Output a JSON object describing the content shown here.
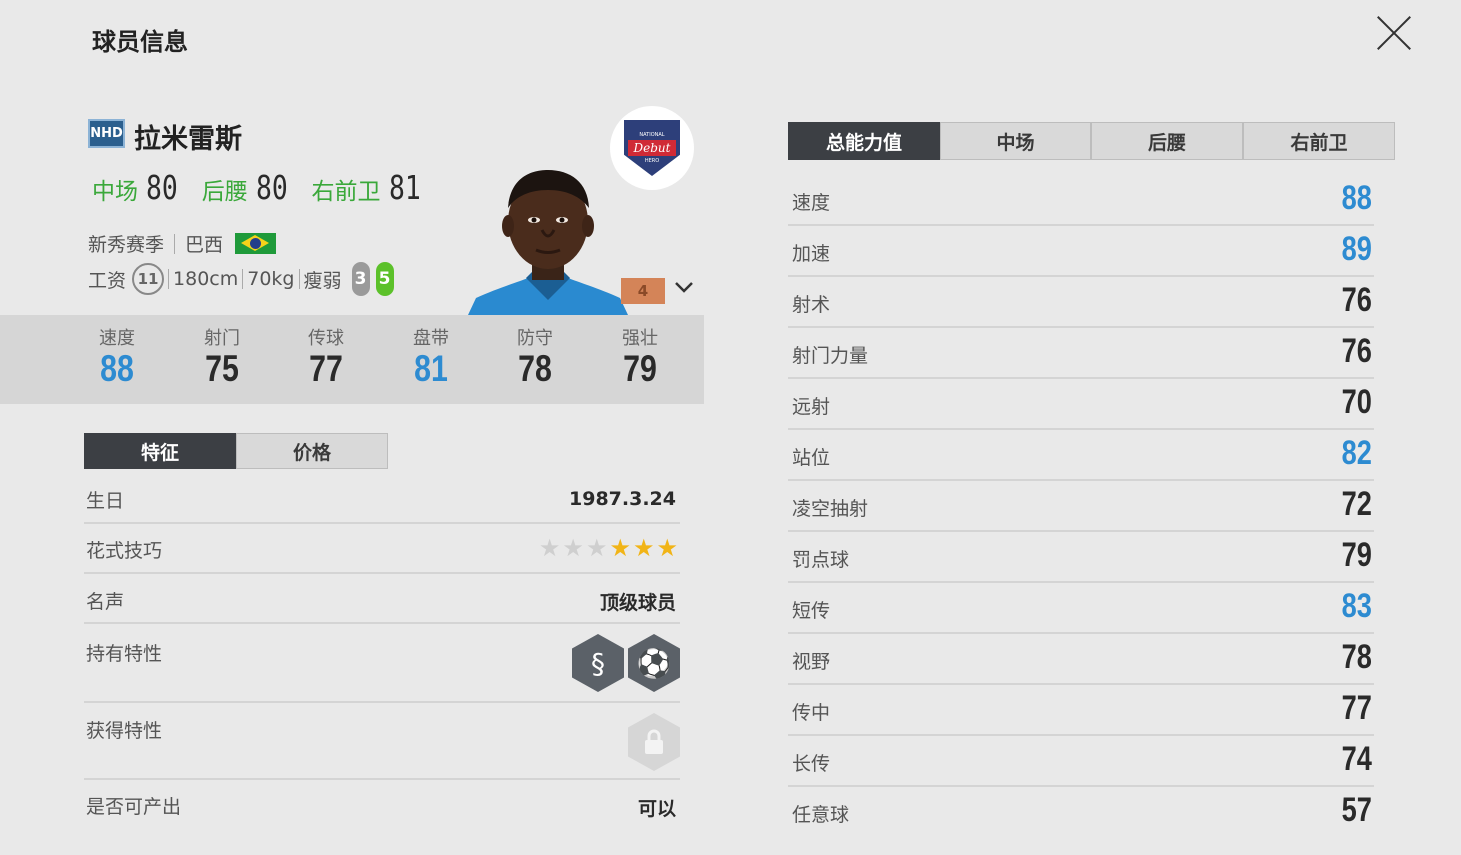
{
  "header": {
    "title": "球员信息",
    "close_icon": "close-icon"
  },
  "player": {
    "season_badge": "NHD",
    "name": "拉米雷斯",
    "positions": [
      {
        "name": "中场",
        "value": "80"
      },
      {
        "name": "后腰",
        "value": "80"
      },
      {
        "name": "右前卫",
        "value": "81"
      }
    ],
    "season": "新秀赛季",
    "nation": "巴西",
    "wage_label": "工资",
    "wage": "11",
    "height": "180cm",
    "weight": "70kg",
    "body_type": "瘦弱",
    "weak_foot": "3",
    "strong_foot": "5",
    "level": "4",
    "card_badge": {
      "top": "NATIONAL",
      "main": "Debut",
      "bottom": "HERO"
    },
    "colors": {
      "position": "#3aa83a",
      "stat_high": "#2d8bd1",
      "tab_active": "#3c3f44"
    }
  },
  "summary_stats": [
    {
      "label": "速度",
      "value": "88",
      "highlight": true
    },
    {
      "label": "射门",
      "value": "75",
      "highlight": false
    },
    {
      "label": "传球",
      "value": "77",
      "highlight": false
    },
    {
      "label": "盘带",
      "value": "81",
      "highlight": true
    },
    {
      "label": "防守",
      "value": "78",
      "highlight": false
    },
    {
      "label": "强壮",
      "value": "79",
      "highlight": false
    }
  ],
  "left_tabs": [
    "特征",
    "价格"
  ],
  "traits": {
    "birthday_label": "生日",
    "birthday": "1987.3.24",
    "skill_label": "花式技巧",
    "skill_stars": 3,
    "skill_stars_max": 6,
    "reputation_label": "名声",
    "reputation": "顶级球员",
    "owned_traits_label": "持有特性",
    "owned_traits_icons": [
      "snake-trait-icon",
      "dribble-trait-icon"
    ],
    "gained_traits_label": "获得特性",
    "gained_traits_icon": "lock-icon",
    "producible_label": "是否可产出",
    "producible": "可以"
  },
  "right_tabs": [
    "总能力值",
    "中场",
    "后腰",
    "右前卫"
  ],
  "attributes": [
    {
      "label": "速度",
      "value": "88",
      "highlight": true
    },
    {
      "label": "加速",
      "value": "89",
      "highlight": true
    },
    {
      "label": "射术",
      "value": "76",
      "highlight": false
    },
    {
      "label": "射门力量",
      "value": "76",
      "highlight": false
    },
    {
      "label": "远射",
      "value": "70",
      "highlight": false
    },
    {
      "label": "站位",
      "value": "82",
      "highlight": true
    },
    {
      "label": "凌空抽射",
      "value": "72",
      "highlight": false
    },
    {
      "label": "罚点球",
      "value": "79",
      "highlight": false
    },
    {
      "label": "短传",
      "value": "83",
      "highlight": true
    },
    {
      "label": "视野",
      "value": "78",
      "highlight": false
    },
    {
      "label": "传中",
      "value": "77",
      "highlight": false
    },
    {
      "label": "长传",
      "value": "74",
      "highlight": false
    },
    {
      "label": "任意球",
      "value": "57",
      "highlight": false
    }
  ]
}
